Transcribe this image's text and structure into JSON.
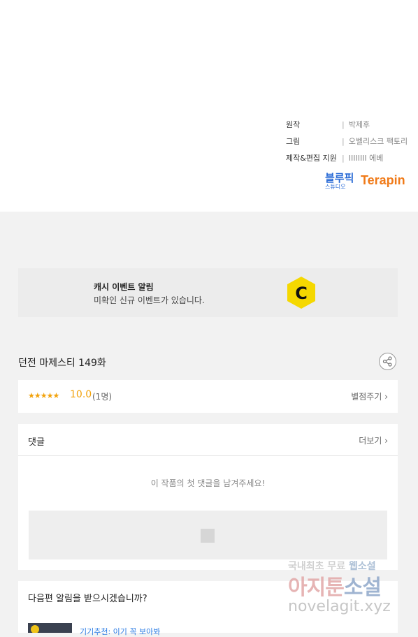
{
  "credits": [
    {
      "label": "원작",
      "value": "박제후"
    },
    {
      "label": "그림",
      "value": "오벨리스크 팩토리"
    },
    {
      "label": "제작&편집 지원",
      "value": "IIIIIIII 에베"
    }
  ],
  "logos": {
    "bluepick": "블루픽",
    "bluepick_sub": "스튜디오",
    "terapin": "Terapin"
  },
  "banner": {
    "title": "캐시 이벤트 알림",
    "subtitle": "미확인 신규 이벤트가 있습니다.",
    "icon_letter": "C"
  },
  "episode": {
    "title": "던전 마제스티 149화"
  },
  "rating": {
    "stars": "★★★★★",
    "score": "10.0",
    "count": "(1명)",
    "rate_link": "별점주기 ›"
  },
  "comments": {
    "heading": "댓글",
    "more": "더보기 ›",
    "empty": "이 작품의 첫 댓글을 남겨주세요!"
  },
  "notify": {
    "heading": "다음편 알림을 받으시겠습니까?",
    "link": "기기추천: 이기 꼭 보아봐"
  },
  "watermark": {
    "line1_a": "국내최초 무료",
    "line1_b": "웹소설",
    "line2_a": "아지툰",
    "line2_b": "소설",
    "line3": "novelagit.xyz"
  },
  "colors": {
    "accent": "#f2a20b",
    "link": "#2a7be4",
    "cash_icon": "#f5d800"
  }
}
